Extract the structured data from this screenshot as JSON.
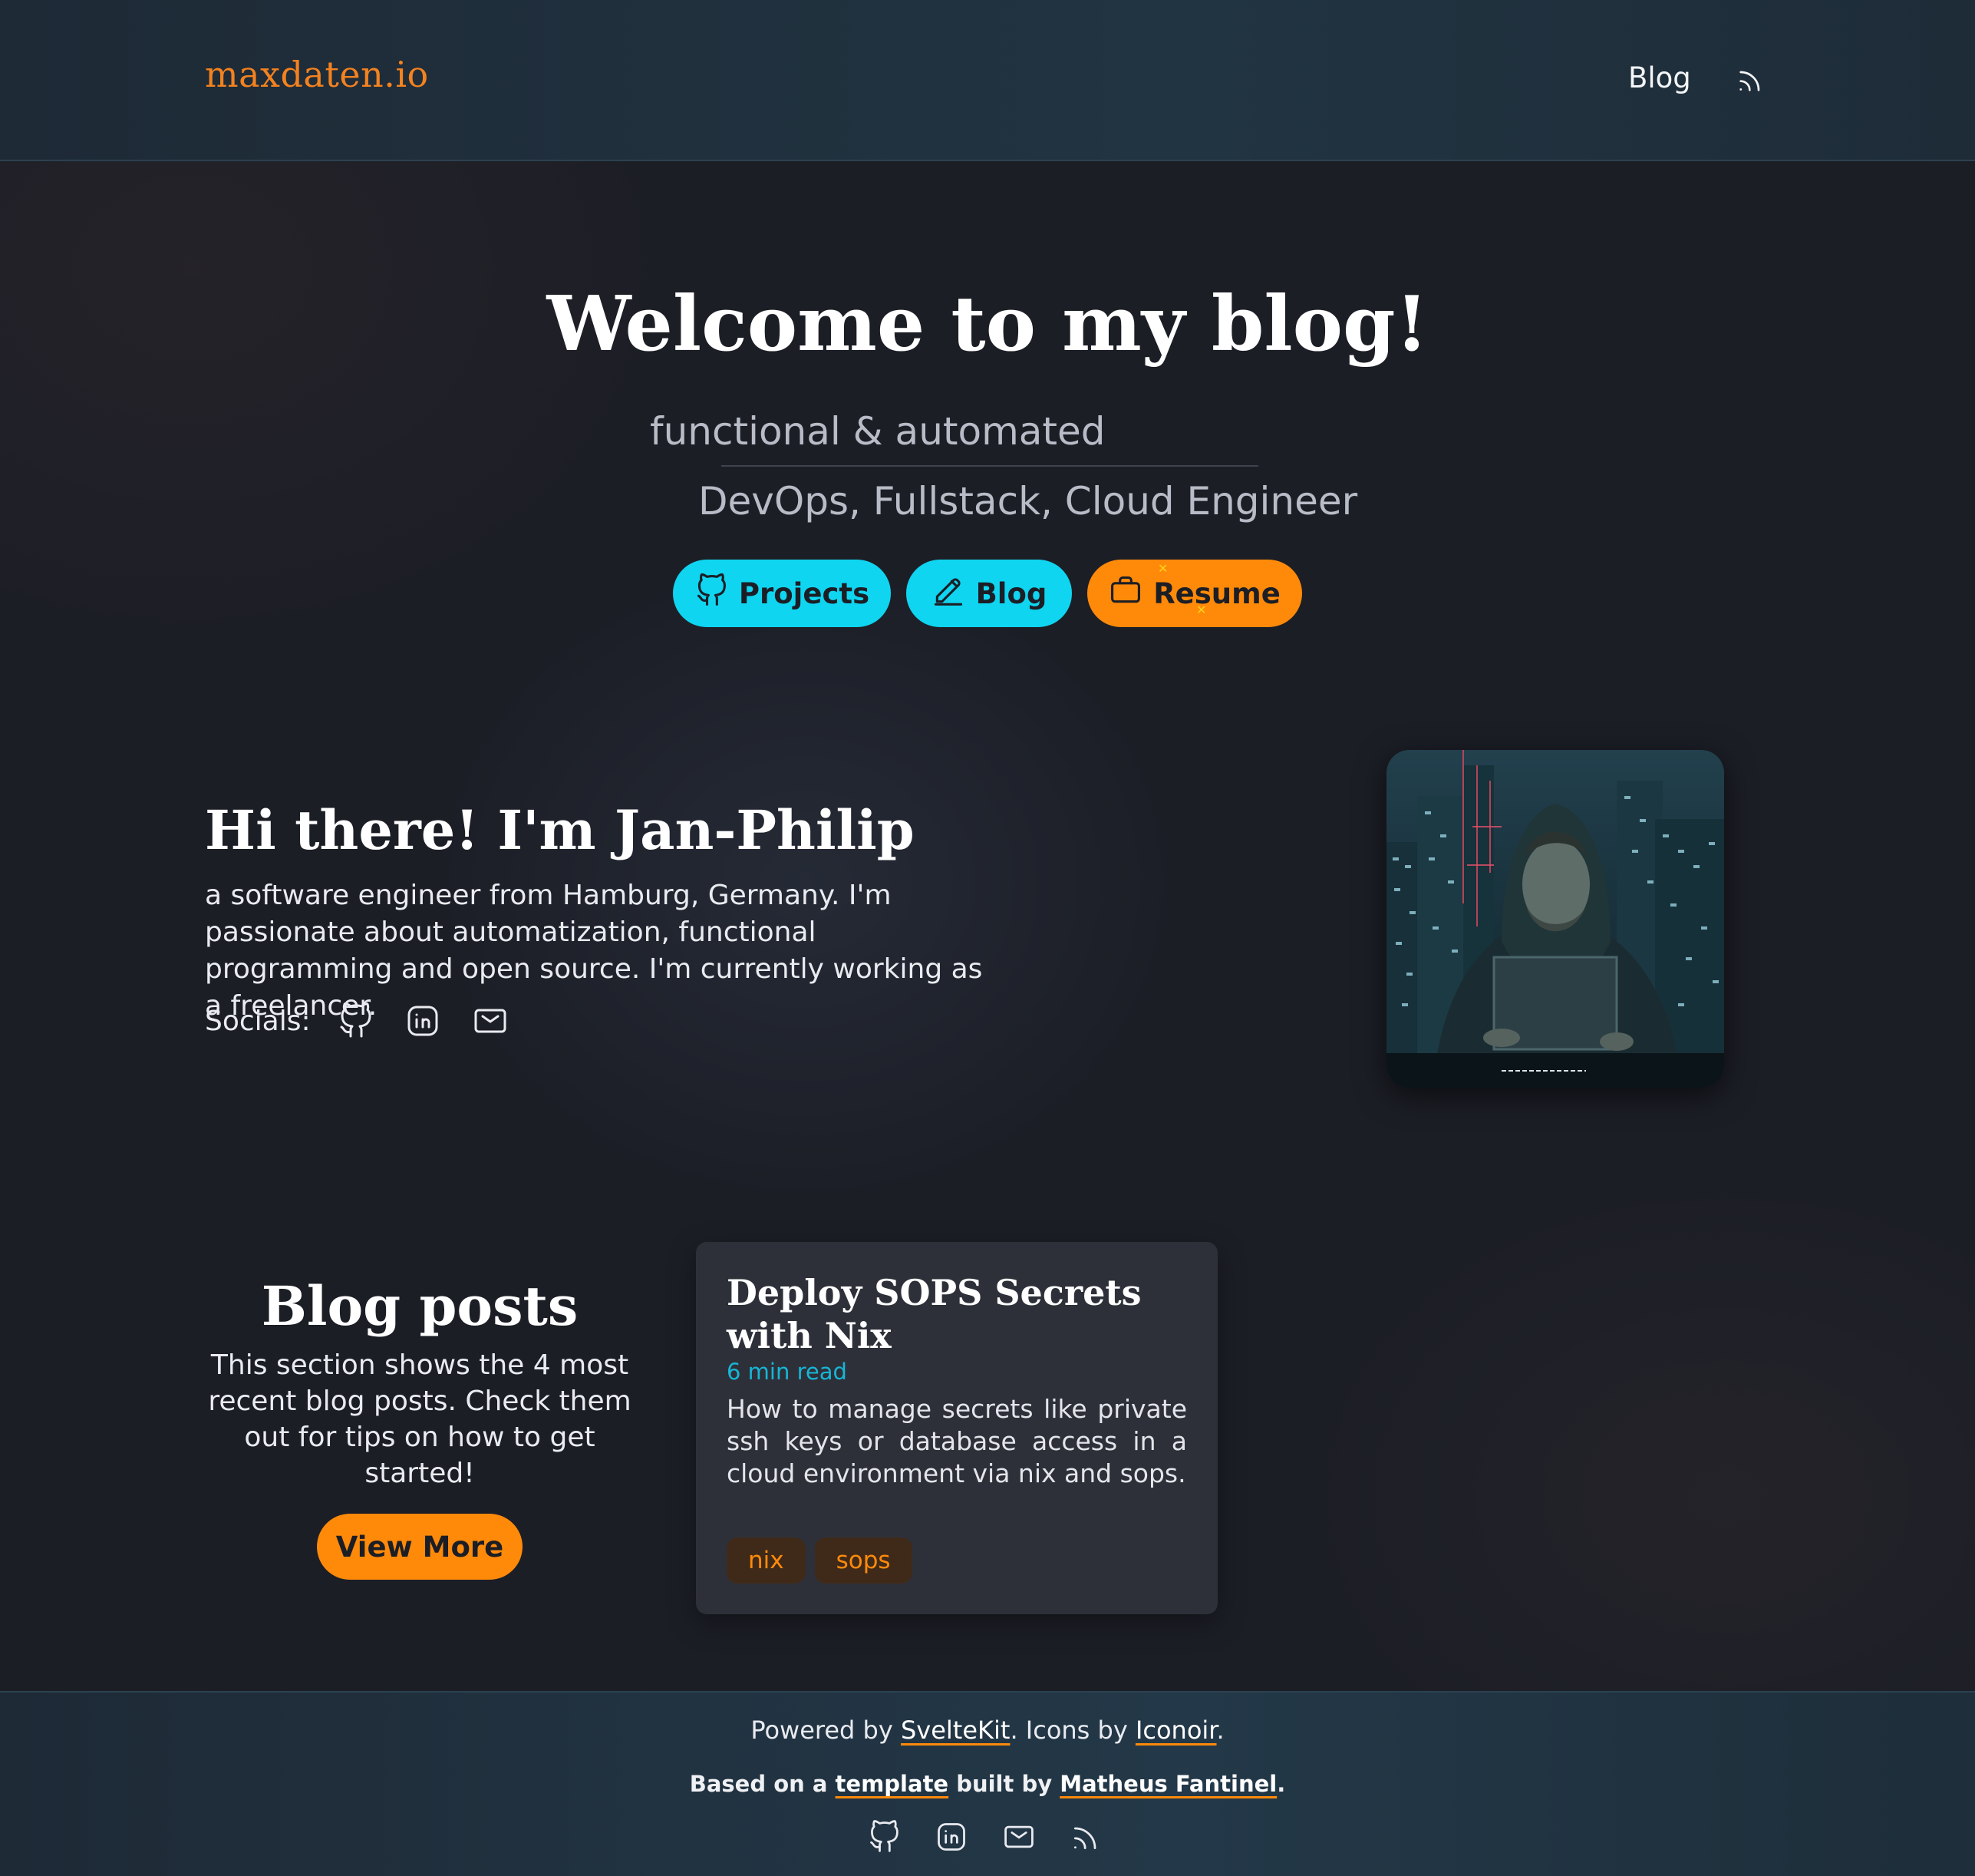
{
  "header": {
    "logo": "maxdaten.io",
    "nav_blog": "Blog",
    "rss_icon": "rss-icon"
  },
  "hero": {
    "title": "Welcome to my blog!",
    "tagline1": "functional & automated",
    "tagline2": "DevOps, Fullstack, Cloud Engineer",
    "buttons": [
      {
        "label": "Projects",
        "icon": "github-icon"
      },
      {
        "label": "Blog",
        "icon": "edit-pencil-icon"
      },
      {
        "label": "Resume",
        "icon": "briefcase-icon"
      }
    ]
  },
  "intro": {
    "title": "Hi there! I'm Jan-Philip",
    "text": "a software engineer from Hamburg, Germany. I'm passionate about automatization, functional programming and open source. I'm currently working as a freelancer.",
    "socials_label": "Socials:",
    "social_icons": [
      "github-icon",
      "linkedin-icon",
      "mail-icon"
    ]
  },
  "blog_section": {
    "title": "Blog posts",
    "description": "This section shows the 4 most recent blog posts. Check them out for tips on how to get started!",
    "view_more": "View More",
    "posts": [
      {
        "title": "Deploy SOPS Secrets with Nix",
        "read_time": "6 min read",
        "excerpt": "How to manage secrets like private ssh keys or database access in a cloud environment via nix and sops.",
        "tags": [
          "nix",
          "sops"
        ]
      }
    ]
  },
  "footer": {
    "powered_prefix": "Powered by ",
    "sveltekit": "SvelteKit",
    "icons_by": ". Icons by ",
    "iconoir": "Iconoir",
    "period": ".",
    "based_prefix": "Based on a ",
    "template": "template",
    "built_by": " built by ",
    "author": "Matheus Fantinel",
    "icons": [
      "github-icon",
      "linkedin-icon",
      "mail-icon",
      "rss-icon"
    ]
  },
  "colors": {
    "accent_orange": "#ff8a0a",
    "accent_cyan": "#0fd5f0",
    "logo_orange": "#f3821f",
    "background": "#1c1e26"
  }
}
